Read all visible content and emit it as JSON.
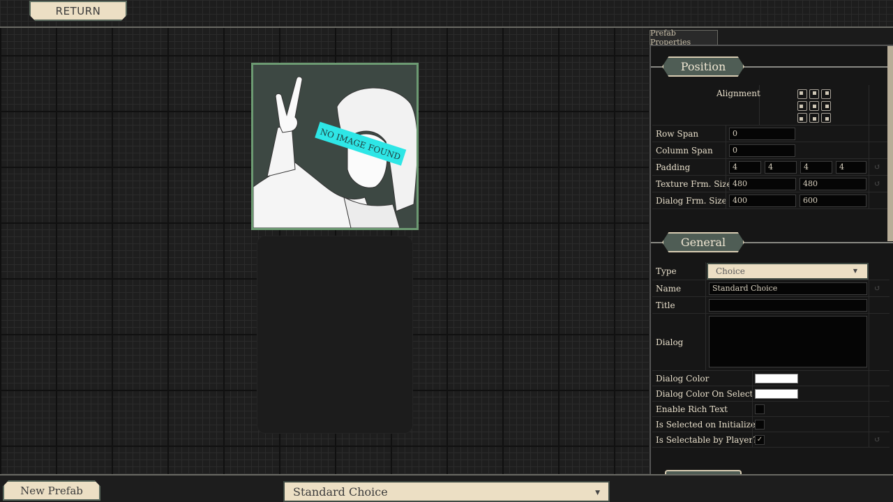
{
  "toolbar": {
    "return_label": "RETURN"
  },
  "canvas": {
    "image_placeholder_text": "NO IMAGE FOUND"
  },
  "bottom": {
    "new_prefab_label": "New Prefab",
    "prefab_selected": "Standard Choice"
  },
  "panel": {
    "tab_label": "Prefab Properties",
    "position": {
      "header": "Position",
      "alignment_label": "Alignment",
      "row_span_label": "Row Span",
      "row_span": "0",
      "column_span_label": "Column Span",
      "column_span": "0",
      "padding_label": "Padding",
      "padding": [
        "4",
        "4",
        "4",
        "4"
      ],
      "texture_size_label": "Texture Frm. Size",
      "texture_size": [
        "480",
        "480"
      ],
      "dialog_size_label": "Dialog Frm. Size",
      "dialog_size": [
        "400",
        "600"
      ]
    },
    "general": {
      "header": "General",
      "type_label": "Type",
      "type_value": "Choice",
      "name_label": "Name",
      "name_value": "Standard Choice",
      "title_label": "Title",
      "title_value": "",
      "dialog_label": "Dialog",
      "dialog_value": "",
      "dialog_color_label": "Dialog Color",
      "dialog_color": "#ffffff",
      "dialog_color_select_label": "Dialog Color On Select",
      "dialog_color_select": "#ffffff",
      "rich_text_label": "Enable Rich Text",
      "rich_text": false,
      "selected_init_label": "Is Selected on Initialize?",
      "selected_init": false,
      "selectable_label": "Is Selectable by Player?",
      "selectable": true,
      "checkmark": "✓"
    }
  },
  "icons": {
    "reset": "reset-icon",
    "dropdown": "chevron-down-icon"
  },
  "colors": {
    "accent_green": "#6c9a72",
    "plate_bg": "#ecdfc4",
    "header_plate": "#4f5d55",
    "placeholder_banner": "#2ee6e6"
  }
}
